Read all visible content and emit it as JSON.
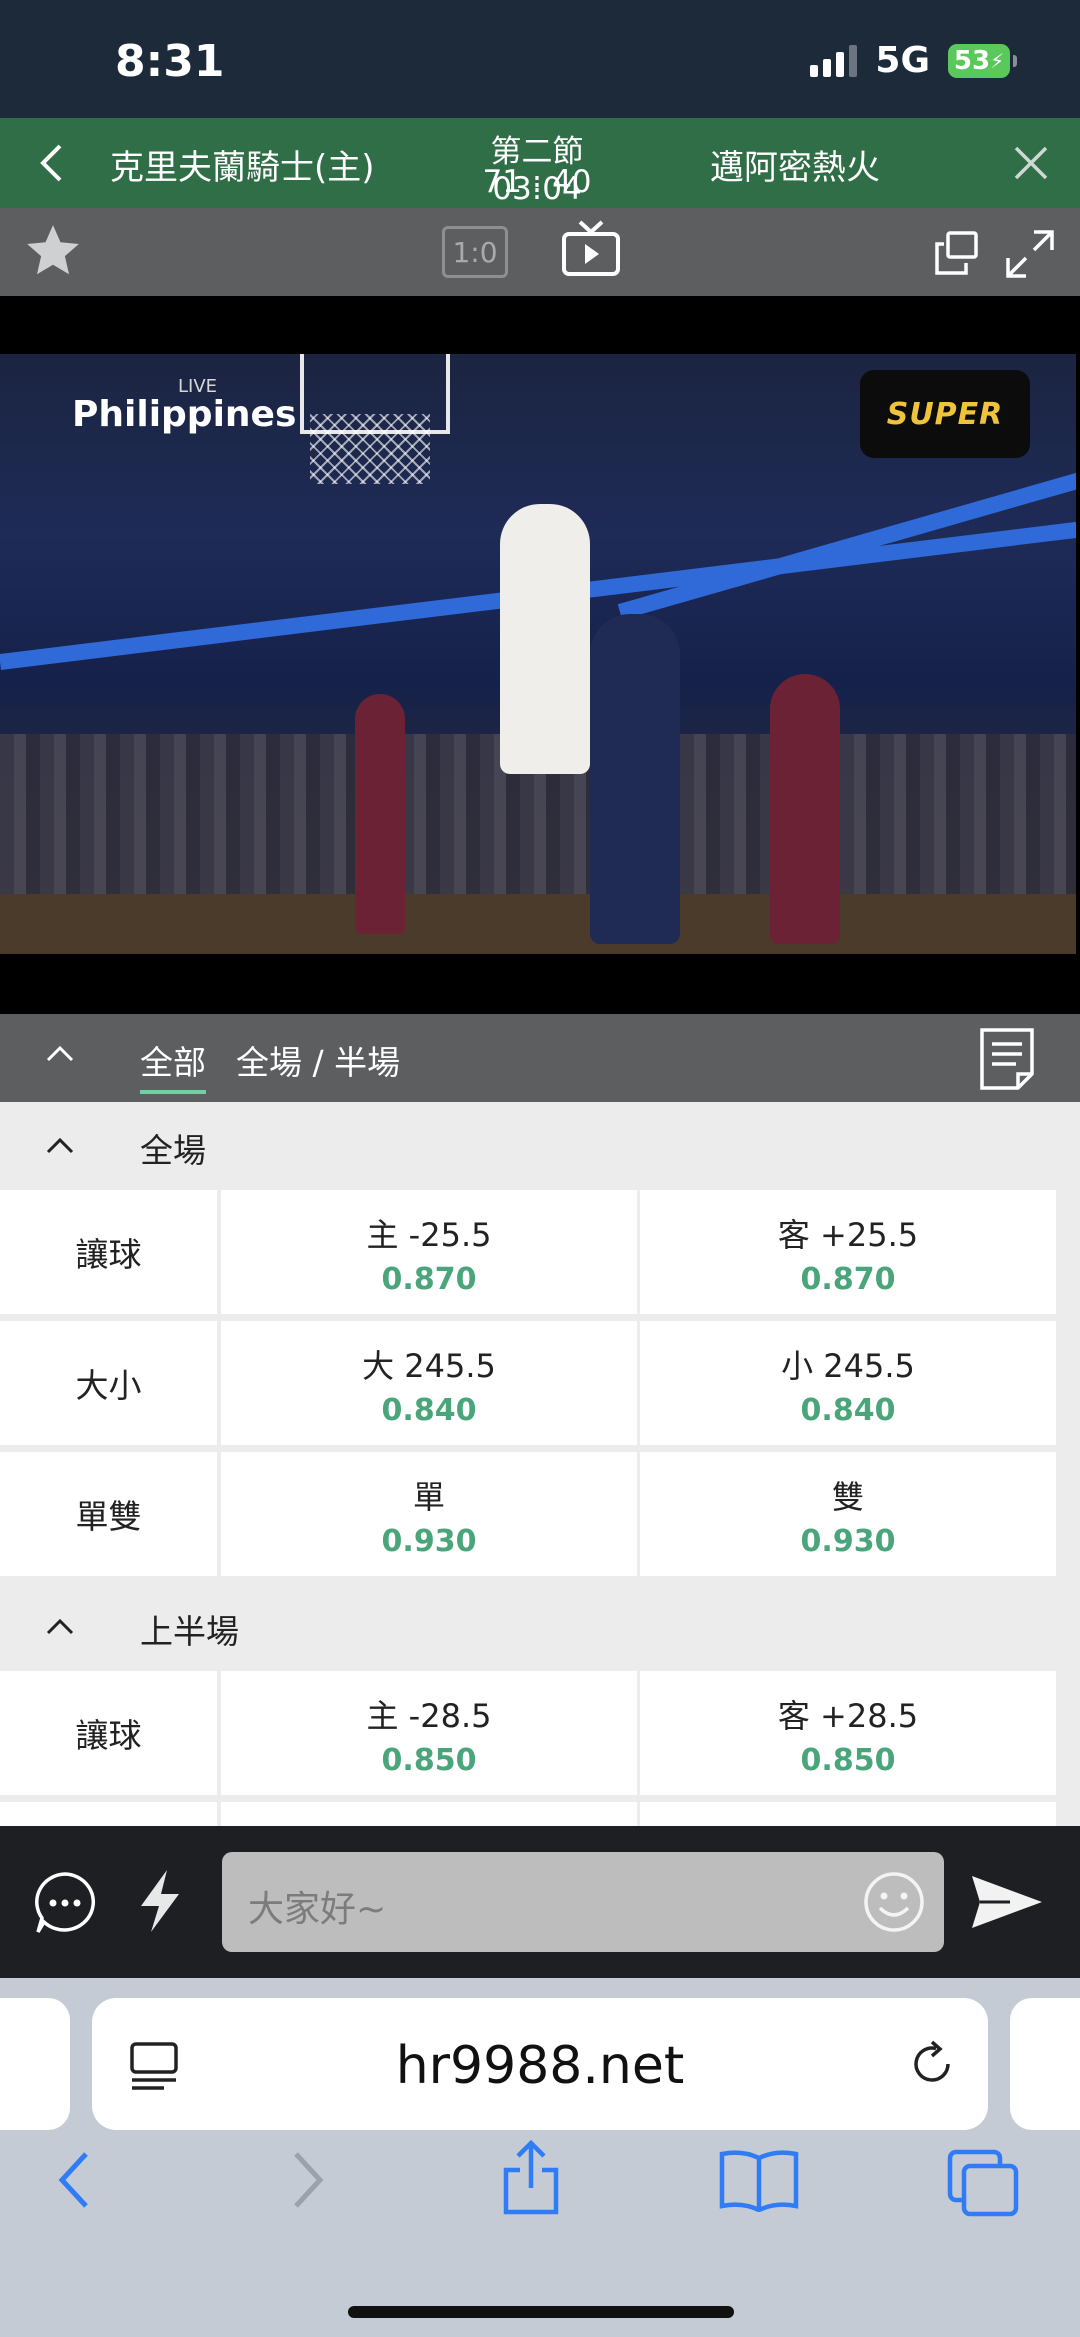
{
  "status_bar": {
    "time": "8:31",
    "network": "5G",
    "battery": "53"
  },
  "match": {
    "home_team": "克里夫蘭騎士(主)",
    "period_clock": "第二節 03:04",
    "score": "71 : 40",
    "away_team": "邁阿密熱火"
  },
  "toolbar": {
    "score_toggle": "1:0"
  },
  "video": {
    "broadcast_watermark": "Philippines",
    "broadcast_live": "LIVE",
    "channel_logo": "SUPER"
  },
  "tabs": {
    "all": "全部",
    "full_half": "全場 / 半場"
  },
  "sections": [
    {
      "title": "全場",
      "rows": [
        {
          "label": "讓球",
          "left": {
            "line": "主 -25.5",
            "odds": "0.870"
          },
          "right": {
            "line": "客 +25.5",
            "odds": "0.870"
          }
        },
        {
          "label": "大小",
          "left": {
            "line": "大 245.5",
            "odds": "0.840"
          },
          "right": {
            "line": "小 245.5",
            "odds": "0.840"
          }
        },
        {
          "label": "單雙",
          "left": {
            "line": "單",
            "odds": "0.930"
          },
          "right": {
            "line": "雙",
            "odds": "0.930"
          }
        }
      ]
    },
    {
      "title": "上半場",
      "rows": [
        {
          "label": "讓球",
          "left": {
            "line": "主 -28.5",
            "odds": "0.850"
          },
          "right": {
            "line": "客 +28.5",
            "odds": "0.850"
          }
        }
      ]
    }
  ],
  "chat": {
    "placeholder": "大家好~"
  },
  "browser": {
    "url": "hr9988.net"
  },
  "colors": {
    "header_green": "#2f6e46",
    "odds_green": "#4aa57a",
    "tab_underline": "#6fd0a3",
    "safari_blue": "#2f7cf6"
  }
}
